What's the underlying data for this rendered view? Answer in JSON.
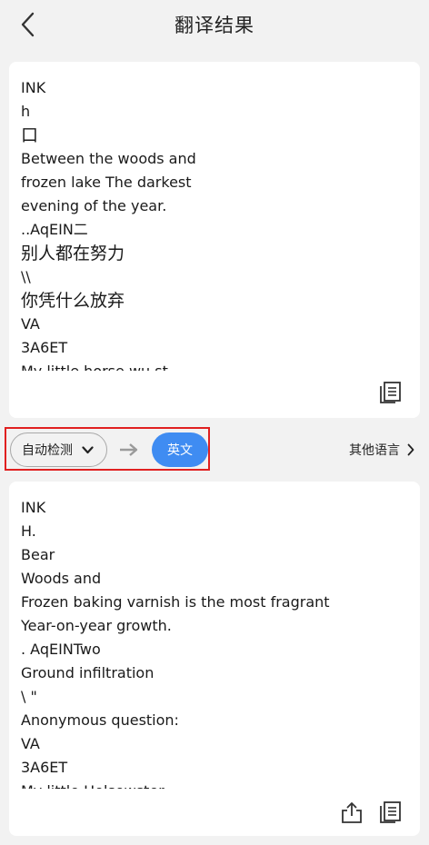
{
  "header": {
    "title": "翻译结果",
    "back_icon": "chevron-left-icon"
  },
  "source": {
    "lines": [
      "INK",
      "h",
      "口",
      "Between the woods and",
      "frozen lake The darkest",
      "evening of the year.",
      "..AqEIN二",
      "别人都在努力",
      "\\\\",
      "你凭什么放弃",
      "VA",
      "3A6ET",
      "My little horse wu st"
    ],
    "copy_icon": "copy-icon"
  },
  "language_bar": {
    "source_lang": "自动检测",
    "dropdown_icon": "chevron-down-icon",
    "arrow_icon": "arrow-right-icon",
    "target_lang": "英文",
    "other_lang": "其他语言",
    "other_icon": "chevron-right-icon",
    "highlight_color": "#e02020",
    "accent_color": "#3f8cf2"
  },
  "target": {
    "lines": [
      "INK",
      "H.",
      "Bear",
      "Woods and",
      "Frozen baking varnish is the most fragrant",
      "Year-on-year growth.",
      ". AqEINTwo",
      "Ground infiltration",
      "\\ \"",
      "Anonymous question:",
      "VA",
      "3A6ET",
      "My little Holsewster"
    ],
    "share_icon": "share-icon",
    "copy_icon": "copy-icon"
  }
}
